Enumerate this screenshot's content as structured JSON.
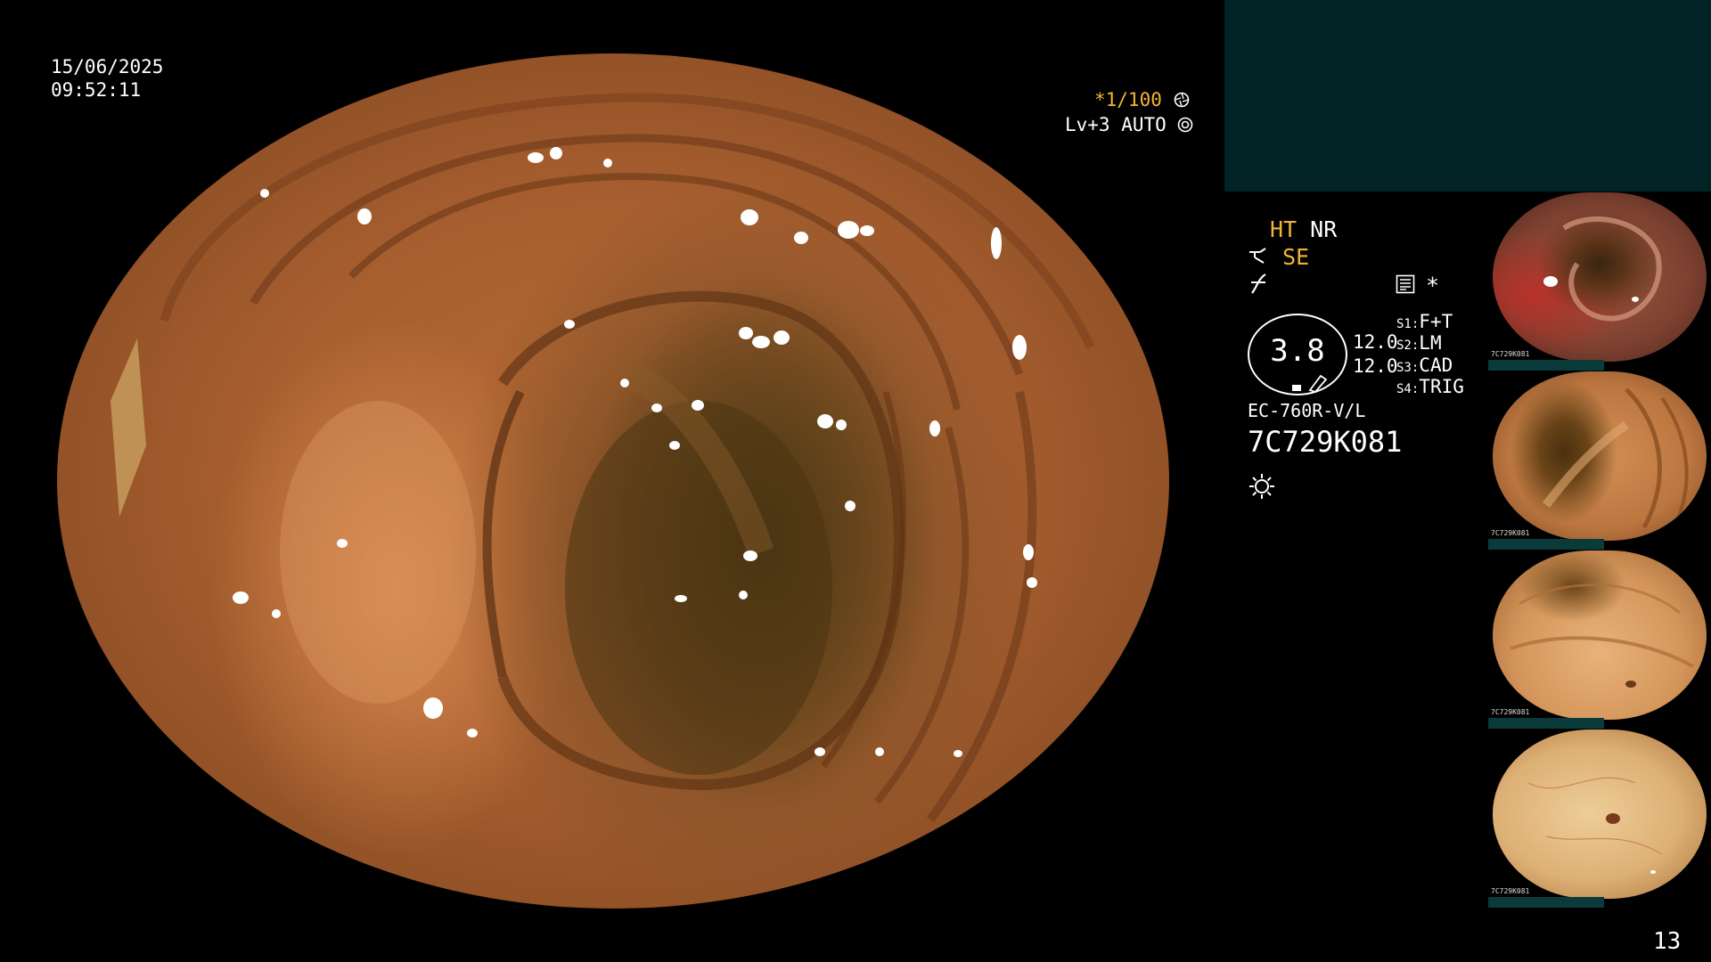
{
  "datetime": {
    "date": "15/06/2025",
    "time": "09:52:11"
  },
  "view_overlay": {
    "ratio": "*1/100",
    "ratio_icon": "aperture-icon",
    "level": "Lv+3 AUTO",
    "level_icon": "target-icon"
  },
  "status": {
    "ht": "HT",
    "nr": "NR",
    "se": "SE",
    "scale_value": "3.8",
    "num_top": "12.0",
    "num_bottom": "12.0",
    "switches": [
      {
        "key": "S1",
        "sep": ":",
        "value": "F+T"
      },
      {
        "key": "S2",
        "sep": ":",
        "value": "LM"
      },
      {
        "key": "S3",
        "sep": ":",
        "value": "CAD"
      },
      {
        "key": "S4",
        "sep": ":",
        "value": "TRIG"
      }
    ],
    "star": "*",
    "scope_model": "EC-760R-V/L",
    "serial": "7C729K081"
  },
  "thumbnails": [
    {
      "id": "1",
      "label": "7C729K081"
    },
    {
      "id": "2",
      "label": "7C729K081"
    },
    {
      "id": "3",
      "label": "7C729K081"
    },
    {
      "id": "4",
      "label": "7C729K081"
    }
  ],
  "page_number": "13",
  "colors": {
    "accent_yellow": "#f3b531",
    "panel_teal": "#022326",
    "thumb_bar": "#0b3a3b"
  }
}
